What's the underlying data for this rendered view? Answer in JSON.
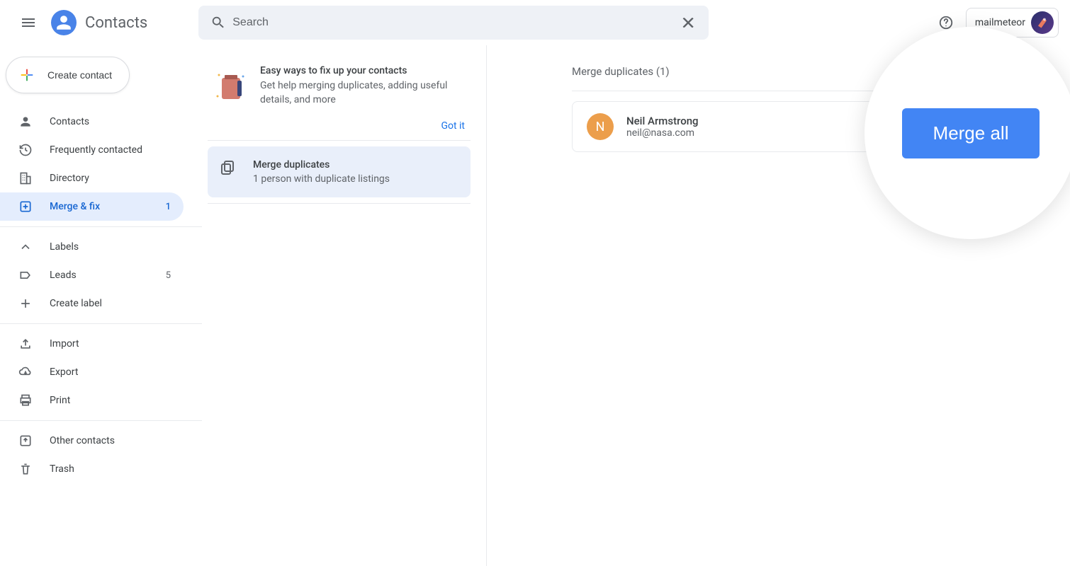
{
  "header": {
    "app_title": "Contacts",
    "search_placeholder": "Search",
    "account_label": "mailmeteor"
  },
  "sidebar": {
    "create_label": "Create contact",
    "items": {
      "contacts": "Contacts",
      "frequently": "Frequently contacted",
      "directory": "Directory",
      "merge_fix": "Merge & fix",
      "merge_fix_count": "1",
      "labels_header": "Labels",
      "leads": "Leads",
      "leads_count": "5",
      "create_label": "Create label",
      "import": "Import",
      "export": "Export",
      "print": "Print",
      "other": "Other contacts",
      "trash": "Trash"
    }
  },
  "middle": {
    "suggest_title": "Easy ways to fix up your contacts",
    "suggest_sub": "Get help merging duplicates, adding useful details, and more",
    "got_it": "Got it",
    "merge_title": "Merge duplicates",
    "merge_sub": "1 person with duplicate listings"
  },
  "right": {
    "title": "Merge duplicates (1)",
    "dup_name": "Neil Armstrong",
    "dup_email": "neil@nasa.com",
    "avatar_letter": "N",
    "avatar_letter2": "N",
    "merge_all": "Merge all"
  }
}
